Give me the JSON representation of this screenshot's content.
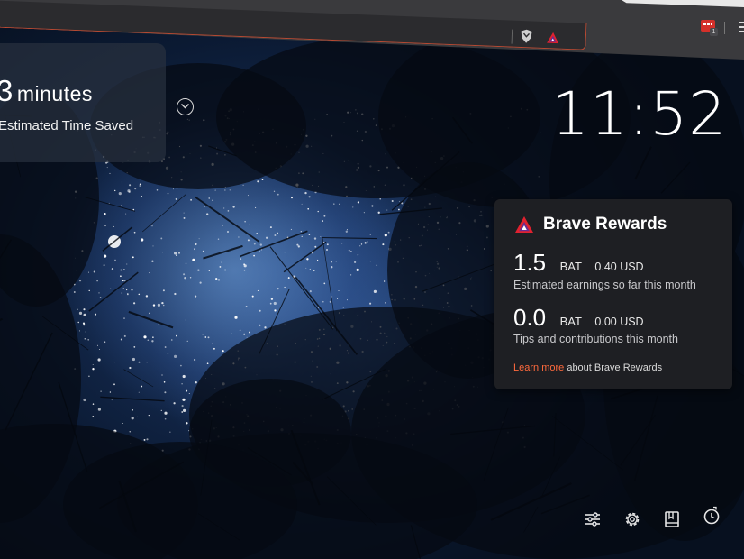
{
  "stats": {
    "value": "3",
    "unit": "minutes",
    "label": "Estimated Time Saved"
  },
  "clock": {
    "time": "11:52"
  },
  "rewards": {
    "title": "Brave Rewards",
    "earnings": {
      "amount": "1.5",
      "currency": "BAT",
      "usd": "0.40 USD",
      "caption": "Estimated earnings so far this month"
    },
    "tips": {
      "amount": "0.0",
      "currency": "BAT",
      "usd": "0.00 USD",
      "caption": "Tips and contributions this month"
    },
    "learn_more_link": "Learn more",
    "learn_more_suffix": " about Brave Rewards"
  },
  "toolbar": {
    "extension_badge": "1",
    "icons": [
      "brave-shield-icon",
      "bat-rewards-icon",
      "extension-icon",
      "menu-icon"
    ]
  },
  "footer_icons": [
    "customize-icon",
    "settings-icon",
    "bookmarks-icon",
    "history-icon"
  ],
  "colors": {
    "accent": "#ff6a3d",
    "card_bg": "#1e1f23",
    "url_border": "#b94a33",
    "bat_red": "#e0212f",
    "bat_purple": "#662d91"
  }
}
